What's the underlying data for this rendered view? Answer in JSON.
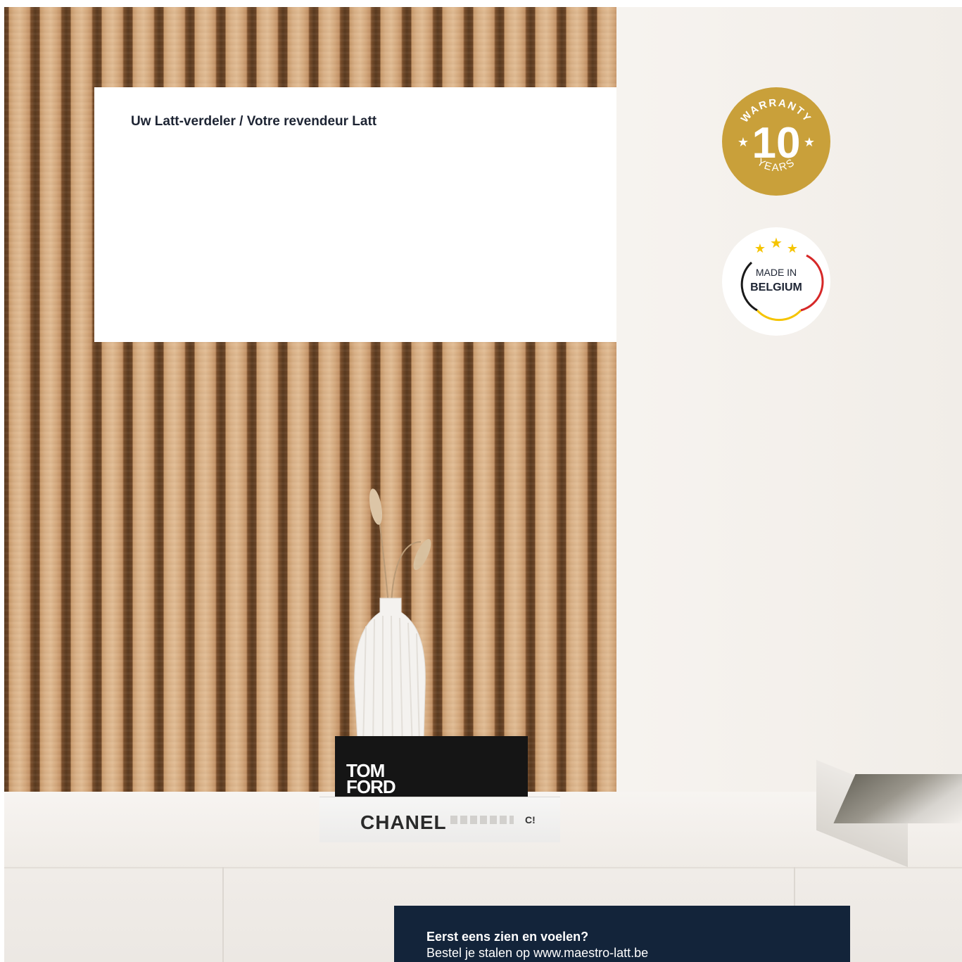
{
  "dealer_panel": {
    "title": "Uw Latt-verdeler / Votre revendeur Latt"
  },
  "warranty_badge": {
    "top_text": "WARRANTY",
    "number": "10",
    "bottom_text": "YEARS",
    "color": "#c9a03a"
  },
  "belgium_badge": {
    "line1": "MADE IN",
    "line2": "BELGIUM",
    "flag_colors": [
      "#1a1a1a",
      "#f5c400",
      "#d62828"
    ],
    "star_color": "#f5c400"
  },
  "decor": {
    "book_black_text": "TOM\nFORD",
    "book_white_text": "CHANEL",
    "book_white_logo": "C!"
  },
  "cta": {
    "title": "Eerst eens zien en voelen?",
    "text": "Bestel je stalen op www.maestro-latt.be",
    "background": "#13243a"
  }
}
